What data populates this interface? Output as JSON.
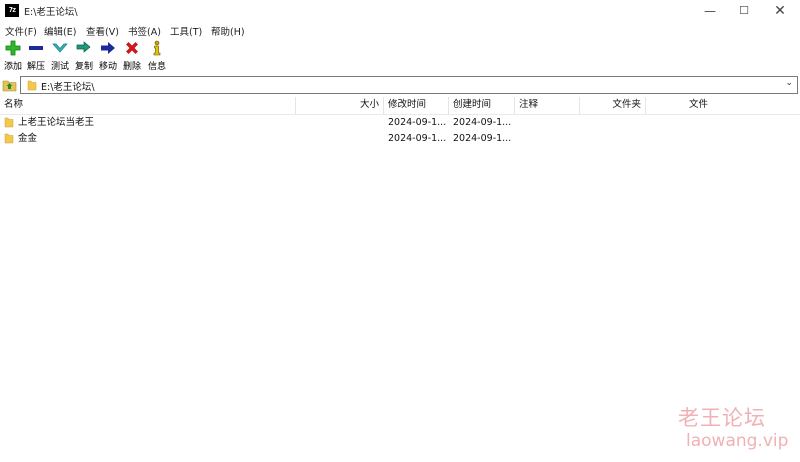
{
  "window": {
    "title": "E:\\老王论坛\\",
    "app_icon_text": "7z",
    "minimize_glyph": "—",
    "maximize_glyph": "☐",
    "close_glyph": "✕"
  },
  "menu": [
    {
      "label": "文件(F)"
    },
    {
      "label": "编辑(E)"
    },
    {
      "label": "查看(V)"
    },
    {
      "label": "书签(A)"
    },
    {
      "label": "工具(T)"
    },
    {
      "label": "帮助(H)"
    }
  ],
  "toolbar": {
    "add": {
      "label": "添加",
      "icon": "plus-icon",
      "color": "#2db82d"
    },
    "extract": {
      "label": "解压",
      "icon": "minus-icon",
      "color": "#1c2a9c"
    },
    "test": {
      "label": "测试",
      "icon": "check-icon",
      "color": "#2ab6c0"
    },
    "copy": {
      "label": "复制",
      "icon": "double-arrow-icon",
      "color": "#1a9a7a"
    },
    "move": {
      "label": "移动",
      "icon": "arrow-right-icon",
      "color": "#1c2a9c"
    },
    "delete": {
      "label": "删除",
      "icon": "x-icon",
      "color": "#cc1a1a"
    },
    "info": {
      "label": "信息",
      "icon": "info-icon",
      "color": "#c9a400"
    }
  },
  "address": {
    "path": "E:\\老王论坛\\",
    "dropdown_glyph": "⌄"
  },
  "columns": {
    "name": "名称",
    "size": "大小",
    "modified": "修改时间",
    "created": "创建时间",
    "comment": "注释",
    "folders": "文件夹",
    "files": "文件"
  },
  "rows": [
    {
      "name": "上老王论坛当老王",
      "modified": "2024-09-1...",
      "created": "2024-09-1..."
    },
    {
      "name": "金金",
      "modified": "2024-09-1...",
      "created": "2024-09-1..."
    }
  ],
  "watermark": {
    "cn": "老王论坛",
    "en": "laowang.vip"
  }
}
